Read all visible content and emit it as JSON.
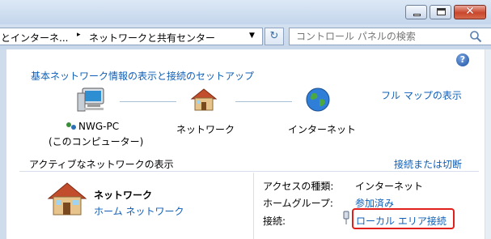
{
  "window": {
    "minimize_icon": "minimize-icon",
    "maximize_icon": "maximize-icon",
    "close_icon": "close-icon",
    "close_glyph": "✕"
  },
  "address_bar": {
    "crumbs": [
      "とインターネ...",
      "ネットワークと共有センター"
    ],
    "separator": "▸",
    "dropdown": "▼",
    "refresh_icon": "refresh-icon",
    "refresh_glyph": "↻"
  },
  "search": {
    "placeholder": "コントロール パネルの検索",
    "icon": "search-icon"
  },
  "main": {
    "help_icon": "help-icon",
    "help_glyph": "?",
    "heading": "基本ネットワーク情報の表示と接続のセットアップ",
    "full_map_link": "フル マップの表示",
    "map": {
      "computer_name": "NWG-PC",
      "computer_sub": "(このコンピューター)",
      "network_label": "ネットワーク",
      "internet_label": "インターネット"
    },
    "active_networks_heading": "アクティブなネットワークの表示",
    "connect_disconnect_link": "接続または切断",
    "active_network": {
      "name": "ネットワーク",
      "type_link": "ホーム ネットワーク",
      "access_type_label": "アクセスの種類:",
      "access_type_value": "インターネット",
      "homegroup_label": "ホームグループ:",
      "homegroup_link": "参加済み",
      "connections_label": "接続:",
      "connection_link": "ローカル エリア接続"
    }
  },
  "colors": {
    "link": "#0f5fb7",
    "highlight": "#e0201d"
  }
}
